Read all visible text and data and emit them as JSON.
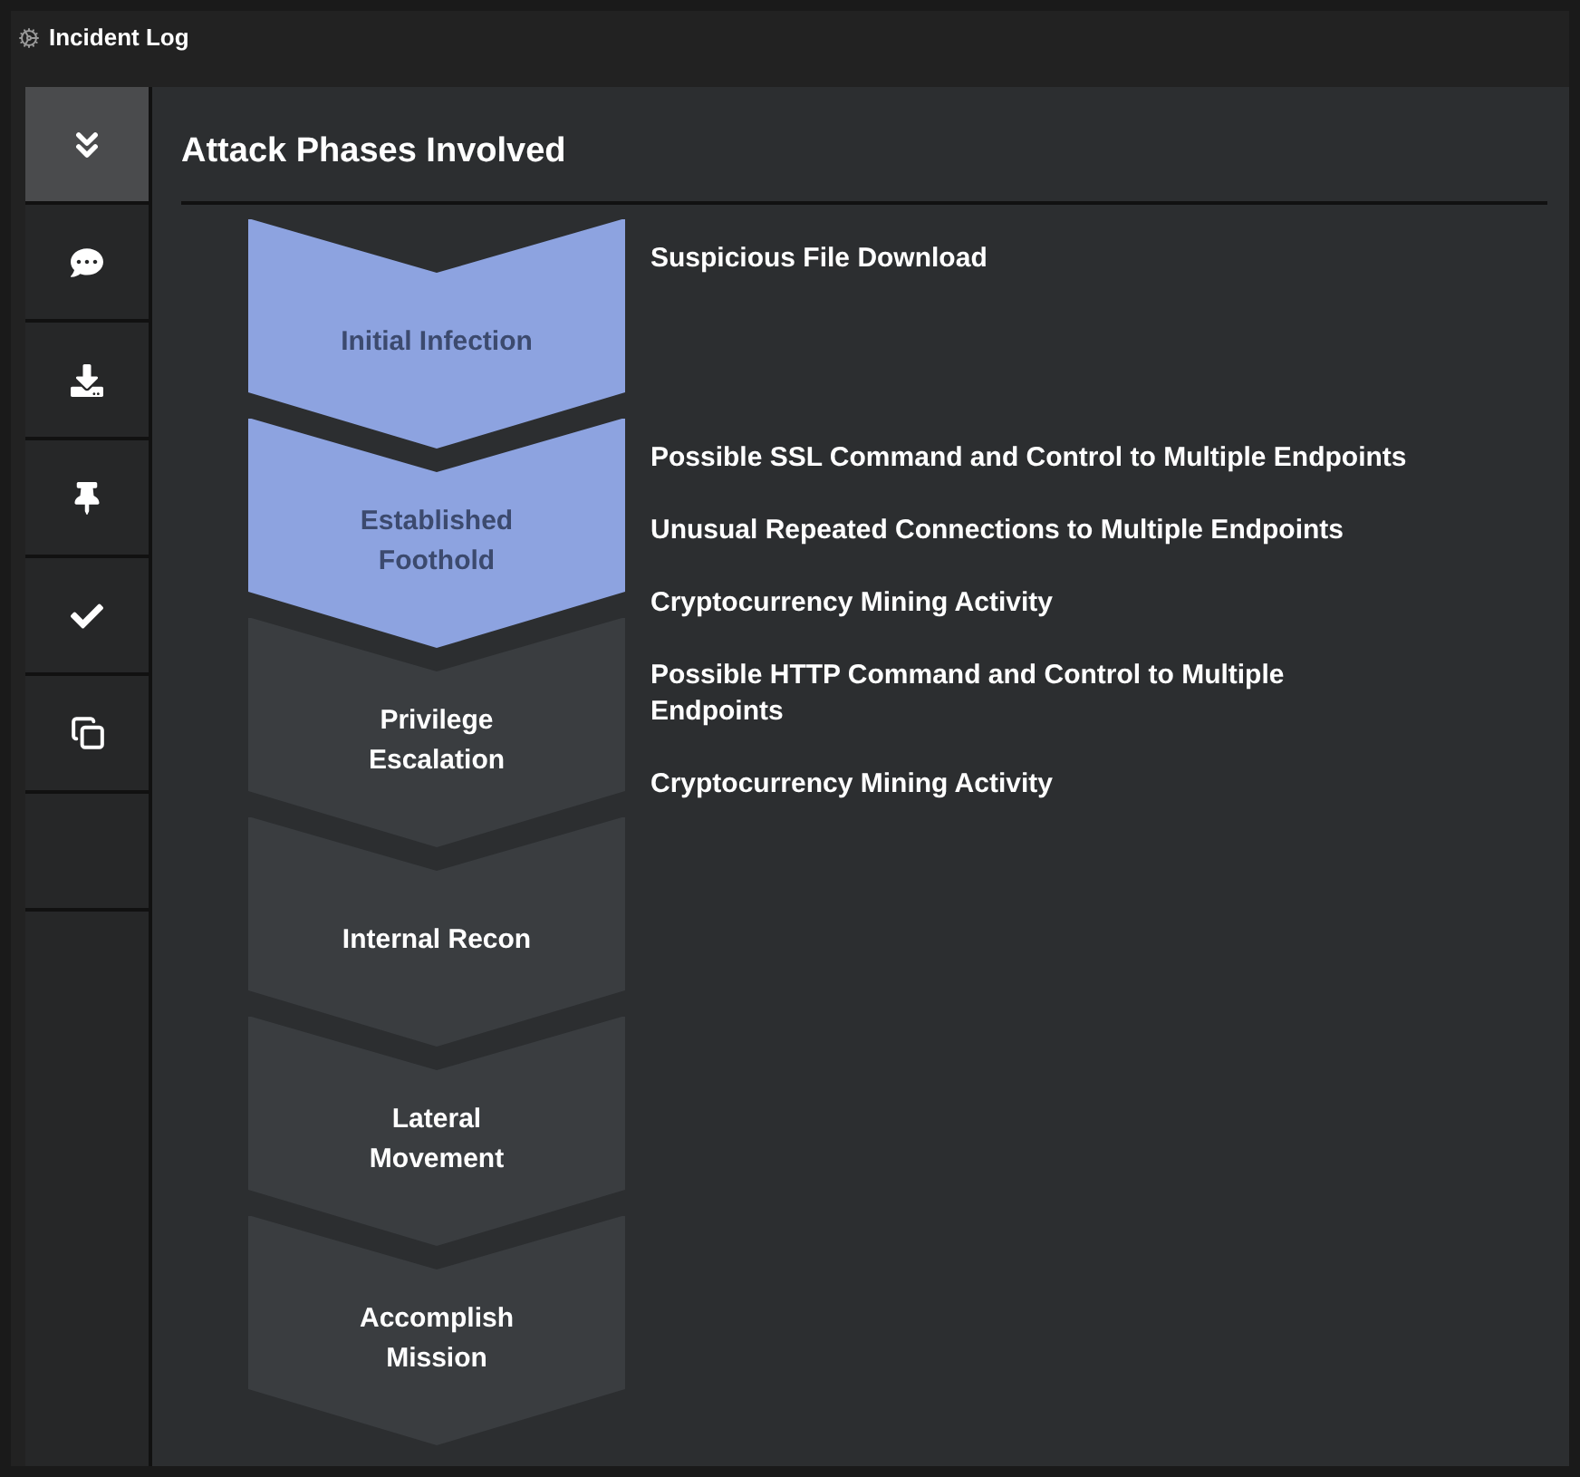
{
  "window": {
    "title": "Incident Log"
  },
  "sidebar": {
    "items": [
      {
        "kind": "collapse",
        "selected": true
      },
      {
        "kind": "comment",
        "selected": false
      },
      {
        "kind": "download",
        "selected": false
      },
      {
        "kind": "pin",
        "selected": false
      },
      {
        "kind": "check",
        "selected": false
      },
      {
        "kind": "copy",
        "selected": false
      },
      {
        "kind": "blank",
        "selected": false
      }
    ]
  },
  "section": {
    "title": "Attack Phases Involved"
  },
  "phases": [
    {
      "label": "Initial Infection",
      "involved": true,
      "alerts": [
        "Suspicious File Download"
      ]
    },
    {
      "label": "Established Foothold",
      "involved": true,
      "alerts": [
        "Possible SSL Command and Control to Multiple Endpoints",
        "Unusual Repeated Connections to Multiple Endpoints",
        "Cryptocurrency Mining Activity",
        "Possible HTTP Command and Control to Multiple Endpoints",
        "Cryptocurrency Mining Activity"
      ]
    },
    {
      "label": "Privilege Escalation",
      "involved": false
    },
    {
      "label": "Internal Recon",
      "involved": false
    },
    {
      "label": "Lateral Movement",
      "involved": false
    },
    {
      "label": "Accomplish Mission",
      "involved": false
    }
  ]
}
